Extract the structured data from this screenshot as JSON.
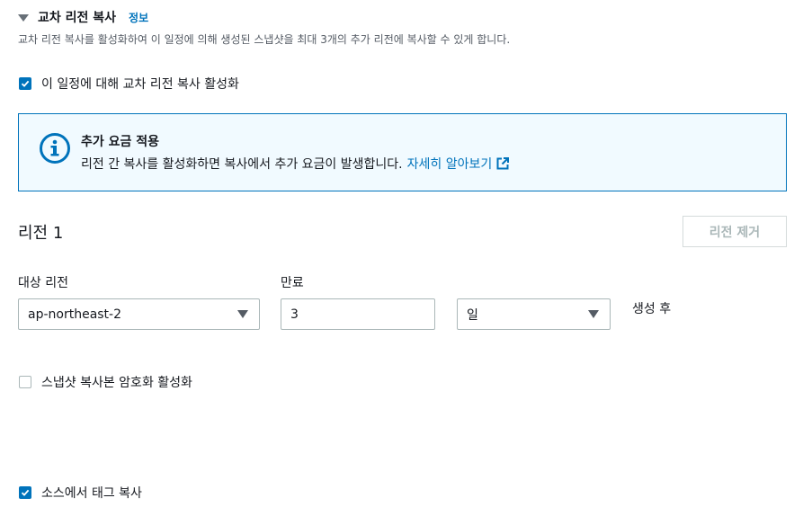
{
  "section": {
    "title": "교차 리전 복사",
    "info_link": "정보",
    "description": "교차 리전 복사를 활성화하여 이 일정에 의해 생성된 스냅샷을 최대 3개의 추가 리전에 복사할 수 있게 합니다."
  },
  "enable_checkbox": {
    "label": "이 일정에 대해 교차 리전 복사 활성화",
    "checked": true
  },
  "alert": {
    "title": "추가 요금 적용",
    "body": "리전 간 복사를 활성화하면 복사에서 추가 요금이 발생합니다.",
    "link": "자세히 알아보기"
  },
  "region": {
    "title": "리전 1",
    "remove_button": "리전 제거",
    "target_label": "대상 리전",
    "target_value": "ap-northeast-2",
    "expiry_label": "만료",
    "expiry_value": "3",
    "unit_value": "일",
    "suffix": "생성 후"
  },
  "encrypt_checkbox": {
    "label": "스냅샷 복사본 암호화 활성화",
    "checked": false
  },
  "copy_tags_checkbox": {
    "label": "소스에서 태그 복사",
    "checked": true
  },
  "colors": {
    "accent": "#0073bb",
    "alert_bg": "#f1faff",
    "border": "#aab7b8",
    "disabled_text": "#aab7b8"
  }
}
